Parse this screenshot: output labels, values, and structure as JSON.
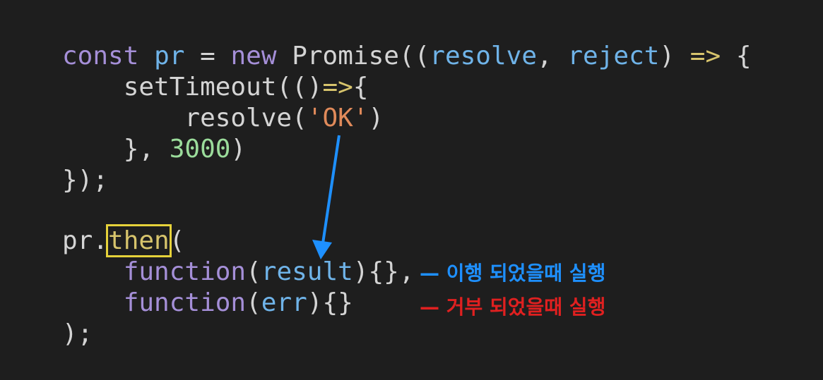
{
  "code": {
    "line1": {
      "kw_const": "const",
      "var_pr": "pr",
      "eq": "=",
      "kw_new": "new",
      "promise": "Promise((",
      "p_resolve": "resolve",
      "comma": ",",
      "p_reject": "reject",
      "close": ")",
      "arrow": "=>",
      "brace": "{"
    },
    "line2": {
      "fn": "setTimeout(()",
      "arrow": "=>",
      "brace": "{"
    },
    "line3": {
      "fn": "resolve(",
      "str": "'OK'",
      "close": ")"
    },
    "line4": {
      "start": "}, ",
      "num": "3000",
      "close": ")"
    },
    "line5": {
      "text": "});"
    },
    "line7": {
      "obj": "pr.",
      "method": "then",
      "open": "("
    },
    "line8": {
      "kw": "function",
      "open": "(",
      "param": "result",
      "close": "){},"
    },
    "line9": {
      "kw": "function",
      "open": "(",
      "param": "err",
      "close": "){}"
    },
    "line10": {
      "text": ");"
    }
  },
  "annotations": {
    "fulfilled": "— 이행 되었을때 실행",
    "rejected": "— 거부 되었을때 실행"
  },
  "colors": {
    "background": "#1e1e1e",
    "keyword": "#a58fd8",
    "param": "#6fb3e8",
    "string": "#e08a5a",
    "number": "#9bdc9b",
    "highlight_box": "#e6d23a",
    "blue_annotation": "#1e90ff",
    "red_annotation": "#e02020"
  }
}
